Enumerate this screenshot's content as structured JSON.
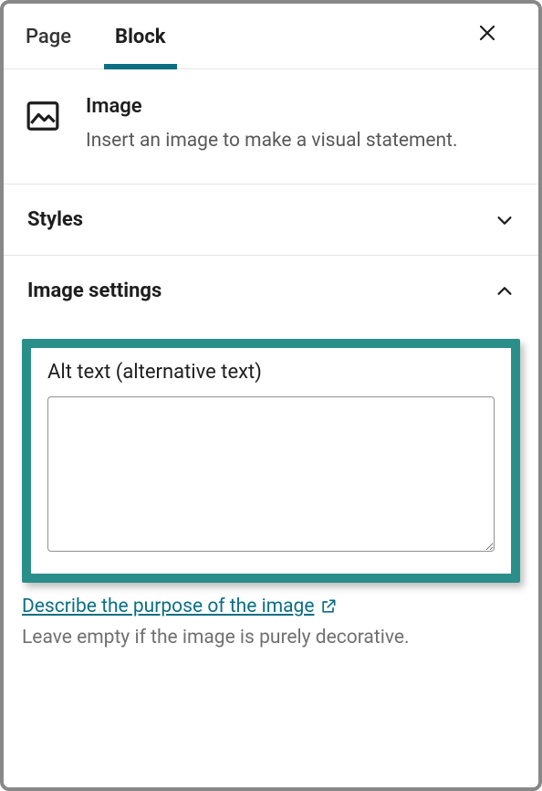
{
  "tabs": {
    "page": "Page",
    "block": "Block"
  },
  "block_info": {
    "title": "Image",
    "description": "Insert an image to make a visual statement."
  },
  "sections": {
    "styles": {
      "title": "Styles",
      "expanded": false
    },
    "image_settings": {
      "title": "Image settings",
      "expanded": true,
      "alt_label": "Alt text (alternative text)",
      "alt_value": "",
      "help_link": "Describe the purpose of the image",
      "help_text": "Leave empty if the image is purely decorative."
    }
  }
}
